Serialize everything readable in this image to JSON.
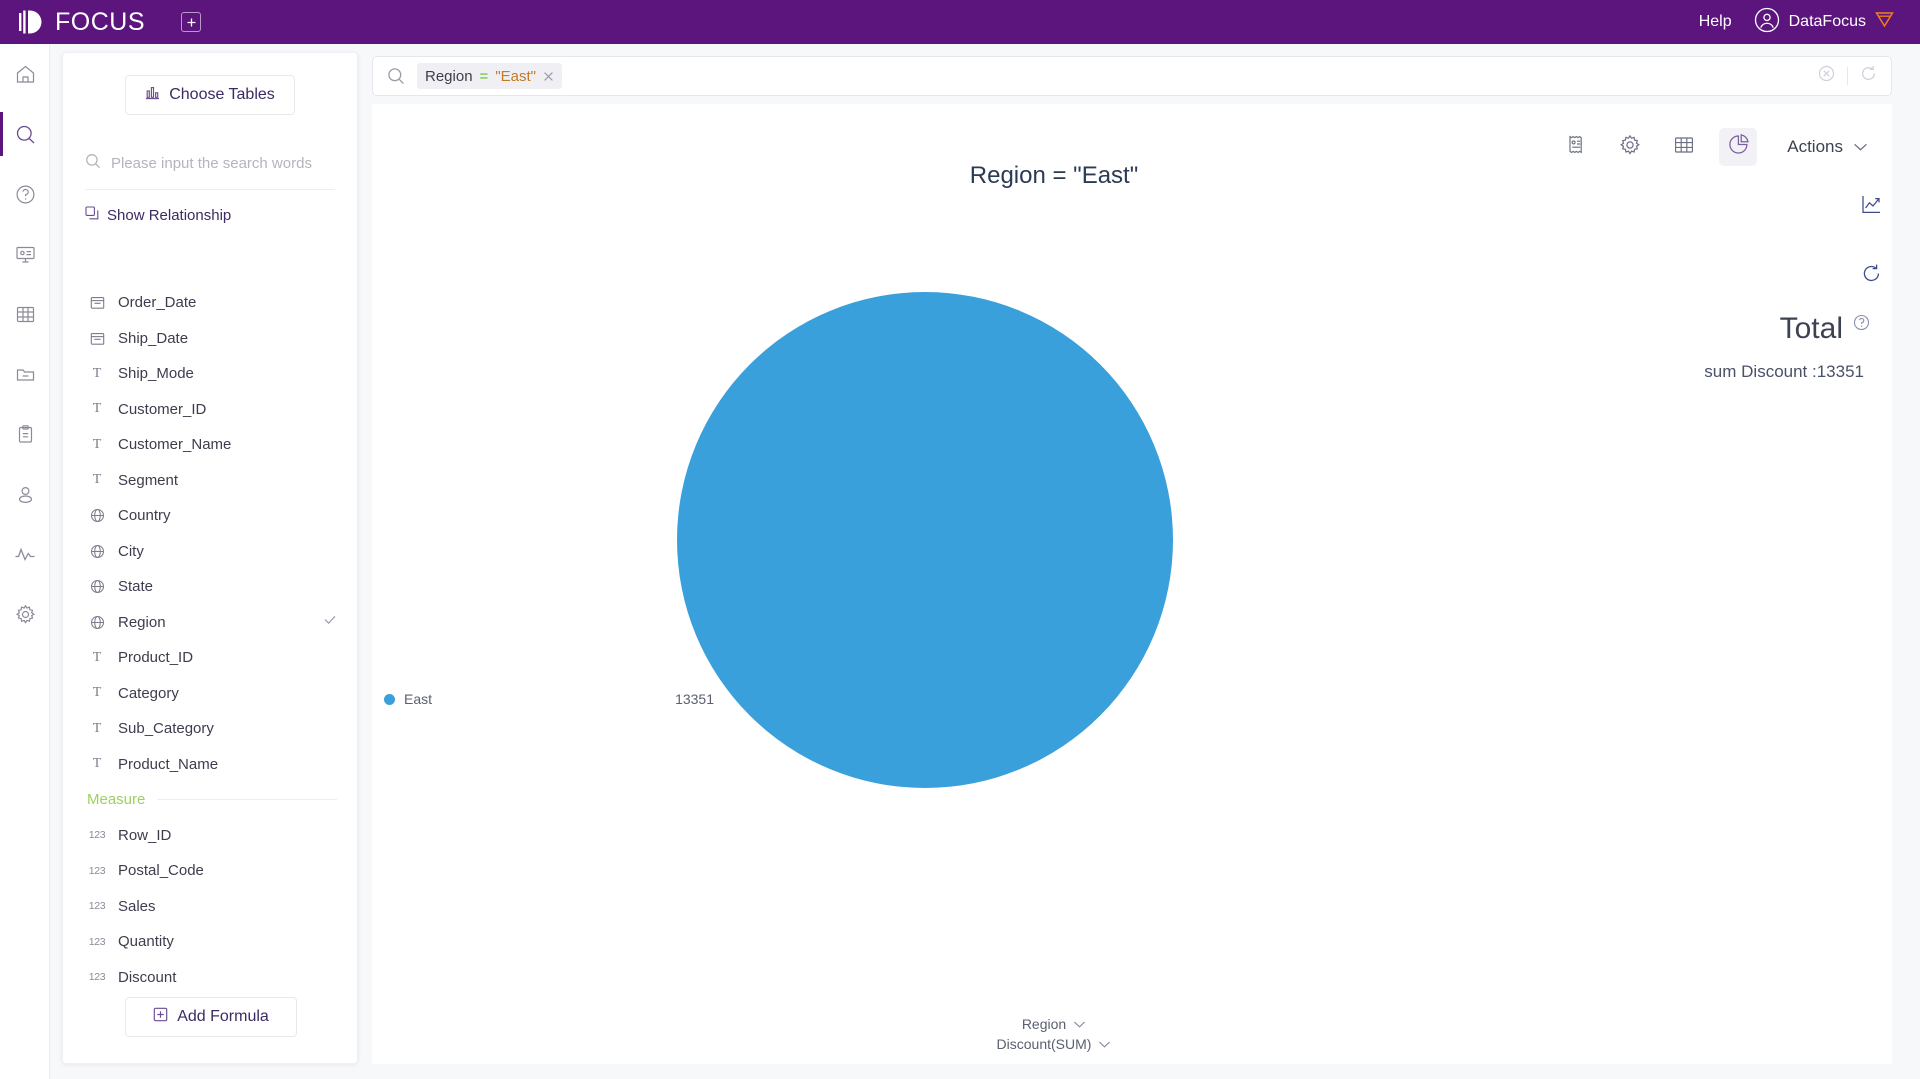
{
  "header": {
    "brand": "FOCUS",
    "logo_icon": "focus-logo-icon",
    "new_tab_icon": "plus-square-icon",
    "help_label": "Help",
    "user_name": "DataFocus",
    "user_icon": "user-circle-icon",
    "badge_icon": "shield-badge-icon",
    "background_color": "#5d157e"
  },
  "rail": {
    "items": [
      {
        "name": "home",
        "icon": "home-icon",
        "active": false
      },
      {
        "name": "search",
        "icon": "search-icon",
        "active": true
      },
      {
        "name": "help",
        "icon": "question-circle-icon",
        "active": false
      },
      {
        "name": "dashboard",
        "icon": "presentation-icon",
        "active": false
      },
      {
        "name": "tables",
        "icon": "grid-table-icon",
        "active": false
      },
      {
        "name": "folder",
        "icon": "folder-minus-icon",
        "active": false
      },
      {
        "name": "tasks",
        "icon": "clipboard-icon",
        "active": false
      },
      {
        "name": "users",
        "icon": "user-icon",
        "active": false
      },
      {
        "name": "monitor",
        "icon": "activity-pulse-icon",
        "active": false
      },
      {
        "name": "settings",
        "icon": "gear-icon",
        "active": false
      }
    ]
  },
  "panel": {
    "choose_tables_label": "Choose Tables",
    "choose_tables_icon": "bar-chart-icon",
    "search_placeholder": "Please input the search words",
    "search_value": "",
    "search_icon": "search-icon",
    "show_relationship_label": "Show Relationship",
    "show_relationship_icon": "relationship-copy-icon",
    "attribute_fields": [
      {
        "label": "Order_Date",
        "icon": "calendar-icon",
        "selected": false
      },
      {
        "label": "Ship_Date",
        "icon": "calendar-icon",
        "selected": false
      },
      {
        "label": "Ship_Mode",
        "icon": "text-type-icon",
        "selected": false
      },
      {
        "label": "Customer_ID",
        "icon": "text-type-icon",
        "selected": false
      },
      {
        "label": "Customer_Name",
        "icon": "text-type-icon",
        "selected": false
      },
      {
        "label": "Segment",
        "icon": "text-type-icon",
        "selected": false
      },
      {
        "label": "Country",
        "icon": "globe-icon",
        "selected": false
      },
      {
        "label": "City",
        "icon": "globe-icon",
        "selected": false
      },
      {
        "label": "State",
        "icon": "globe-icon",
        "selected": false
      },
      {
        "label": "Region",
        "icon": "globe-icon",
        "selected": true
      },
      {
        "label": "Product_ID",
        "icon": "text-type-icon",
        "selected": false
      },
      {
        "label": "Category",
        "icon": "text-type-icon",
        "selected": false
      },
      {
        "label": "Sub_Category",
        "icon": "text-type-icon",
        "selected": false
      },
      {
        "label": "Product_Name",
        "icon": "text-type-icon",
        "selected": false
      }
    ],
    "measure_group_label": "Measure",
    "measure_group_color": "#9ed05f",
    "measure_fields": [
      {
        "label": "Row_ID",
        "icon": "number-123-icon",
        "selected": false
      },
      {
        "label": "Postal_Code",
        "icon": "number-123-icon",
        "selected": false
      },
      {
        "label": "Sales",
        "icon": "number-123-icon",
        "selected": false
      },
      {
        "label": "Quantity",
        "icon": "number-123-icon",
        "selected": false
      },
      {
        "label": "Discount",
        "icon": "number-123-icon",
        "selected": false
      }
    ],
    "add_formula_label": "Add Formula",
    "add_formula_icon": "plus-square-icon"
  },
  "searchbar": {
    "leading_icon": "search-icon",
    "chip": {
      "field": "Region",
      "operator": "=",
      "value": "\"East\"",
      "remove_icon": "close-x-icon",
      "operator_color": "#58c322",
      "value_color": "#c07a28"
    },
    "clear_icon": "clear-circle-icon",
    "refresh_icon": "refresh-icon"
  },
  "viz": {
    "toolbar": [
      {
        "name": "summary",
        "icon": "receipt-icon",
        "active": false
      },
      {
        "name": "settings",
        "icon": "gear-icon",
        "active": false
      },
      {
        "name": "table-view",
        "icon": "grid-table-icon",
        "active": false
      },
      {
        "name": "chart-view",
        "icon": "pie-chart-icon",
        "active": true
      }
    ],
    "actions_label": "Actions",
    "actions_chevron_icon": "chevron-down-icon",
    "side_icons": [
      {
        "name": "trend-chart",
        "icon": "line-chart-icon"
      },
      {
        "name": "reload-chart",
        "icon": "refresh-icon"
      }
    ],
    "total_title": "Total",
    "total_help_icon": "question-circle-icon",
    "total_subtext": "sum Discount :13351",
    "x_axis_pill": "Region",
    "y_axis_pill": "Discount(SUM)",
    "axis_chevron_icon": "chevron-down-icon"
  },
  "chart_data": {
    "type": "pie",
    "title": "Region = \"East\"",
    "xlabel": "Region",
    "ylabel": "Discount(SUM)",
    "grid": false,
    "legend_position": "left",
    "total": 13351,
    "categories": [
      "East"
    ],
    "values": [
      13351
    ],
    "colors": [
      "#3aa0db"
    ],
    "legend": [
      {
        "label": "East",
        "value": "13351",
        "color": "#3aa0db"
      }
    ]
  }
}
